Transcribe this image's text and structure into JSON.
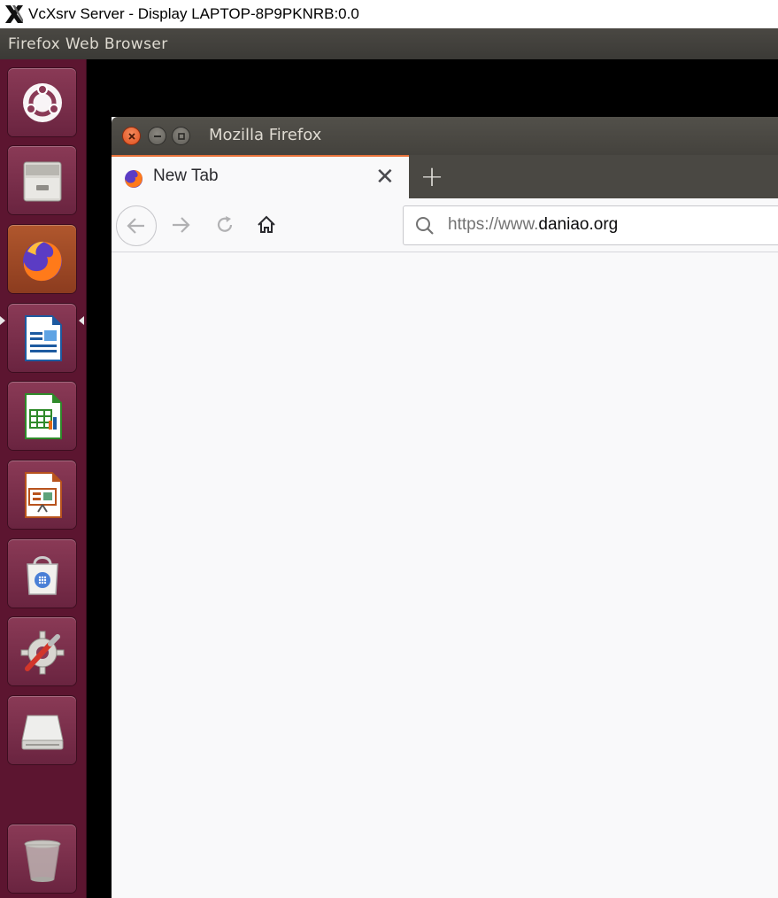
{
  "host": {
    "title": "VcXsrv Server - Display LAPTOP-8P9PKNRB:0.0"
  },
  "panel": {
    "app_name": "Firefox Web Browser"
  },
  "launcher": {
    "items": [
      {
        "name": "ubuntu-logo-icon"
      },
      {
        "name": "files-icon"
      },
      {
        "name": "firefox-icon",
        "active": true
      },
      {
        "name": "writer-icon"
      },
      {
        "name": "calc-icon"
      },
      {
        "name": "impress-icon"
      },
      {
        "name": "software-center-icon"
      },
      {
        "name": "system-settings-icon"
      },
      {
        "name": "drive-icon"
      },
      {
        "name": "trash-icon"
      }
    ]
  },
  "window": {
    "title": "Mozilla Firefox"
  },
  "tabs": [
    {
      "label": "New Tab",
      "close": "✕"
    }
  ],
  "newtab_symbol": "+",
  "urlbar": {
    "scheme_prefix": "https://www.",
    "domain": "daniao.org"
  },
  "colors": {
    "launcher_bg": "#5c1530",
    "panel_bg": "#3b3a36",
    "tab_accent": "#e8733b",
    "close_button": "#e0501e"
  }
}
